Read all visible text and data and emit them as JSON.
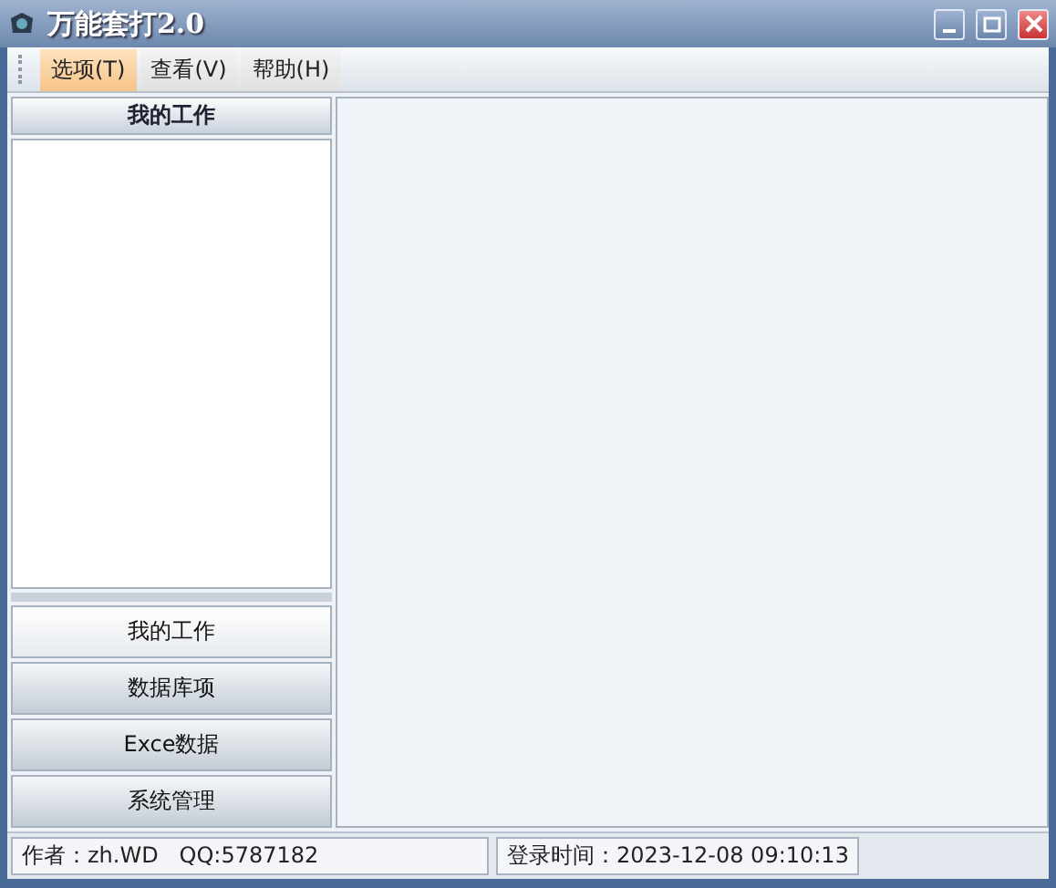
{
  "window": {
    "title": "万能套打2.0"
  },
  "menu": [
    {
      "label": "选项(T)",
      "selected": true
    },
    {
      "label": "查看(V)",
      "selected": false
    },
    {
      "label": "帮助(H)",
      "selected": false
    }
  ],
  "sidebar": {
    "header": "我的工作",
    "nav": [
      {
        "label": "我的工作",
        "selected": true
      },
      {
        "label": "数据库项",
        "selected": false
      },
      {
        "label": "Exce数据",
        "selected": false
      },
      {
        "label": "系统管理",
        "selected": false
      }
    ]
  },
  "status_bar": [
    "作者：zh.WD   QQ:5787182",
    "登录时间：2023-12-08 09:10:13"
  ]
}
